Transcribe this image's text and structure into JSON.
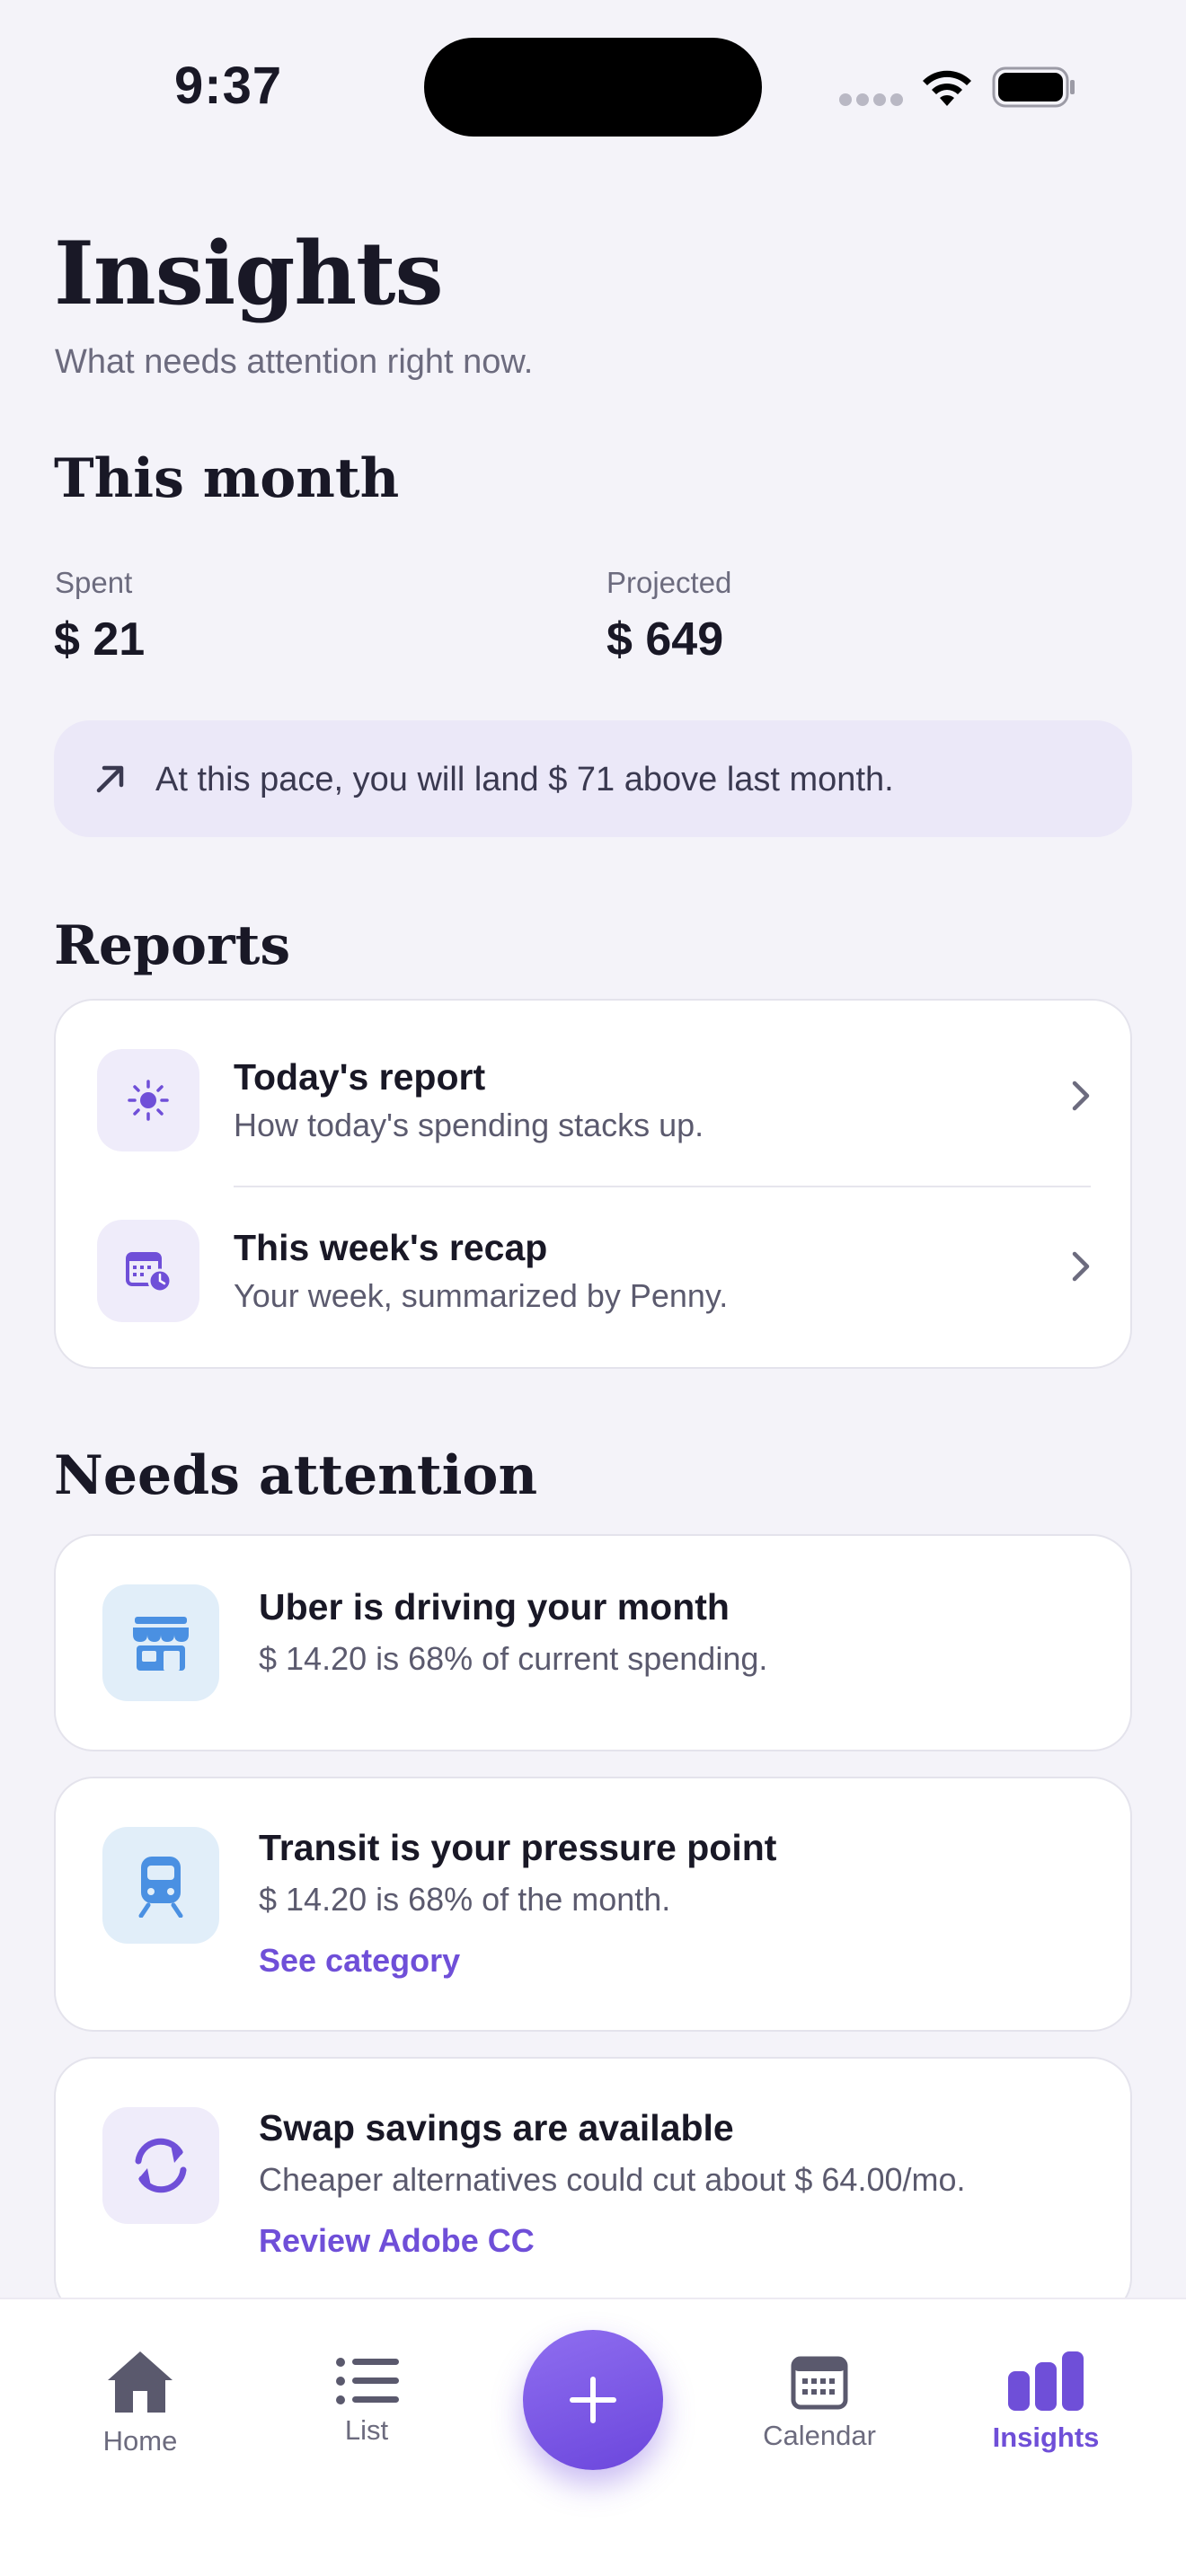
{
  "status_bar": {
    "time": "9:37"
  },
  "header": {
    "title": "Insights",
    "subtitle": "What needs attention right now."
  },
  "this_month": {
    "title": "This month",
    "spent": {
      "label": "Spent",
      "value": "$ 21"
    },
    "projected": {
      "label": "Projected",
      "value": "$ 649"
    },
    "pace_text": "At this pace, you will land $ 71 above last month."
  },
  "reports": {
    "title": "Reports",
    "items": [
      {
        "title": "Today's report",
        "subtitle": "How today's spending stacks up.",
        "icon": "sun-icon"
      },
      {
        "title": "This week's recap",
        "subtitle": "Your week, summarized by Penny.",
        "icon": "calendar-clock-icon"
      }
    ]
  },
  "needs_attention": {
    "title": "Needs attention",
    "items": [
      {
        "title": "Uber is driving your month",
        "subtitle": "$ 14.20 is 68% of current spending.",
        "link": "",
        "icon": "storefront-icon"
      },
      {
        "title": "Transit is your pressure point",
        "subtitle": "$ 14.20 is 68% of the month.",
        "link": "See category",
        "icon": "tram-icon"
      },
      {
        "title": "Swap savings are available",
        "subtitle": "Cheaper alternatives could cut about $ 64.00/mo.",
        "link": "Review Adobe CC",
        "icon": "swap-arrows-icon"
      }
    ]
  },
  "tab_bar": {
    "tabs": [
      {
        "label": "Home",
        "icon": "house-icon",
        "active": false
      },
      {
        "label": "List",
        "icon": "list-icon",
        "active": false
      },
      {
        "label": "Calendar",
        "icon": "calendar-icon",
        "active": false
      },
      {
        "label": "Insights",
        "icon": "bar-chart-icon",
        "active": true
      }
    ],
    "add_icon": "plus-icon"
  },
  "colors": {
    "accent": "#6f4fd8",
    "background": "#f4f3f9",
    "banner": "#ebe8f8",
    "icon_blue": "#4a90e2"
  }
}
